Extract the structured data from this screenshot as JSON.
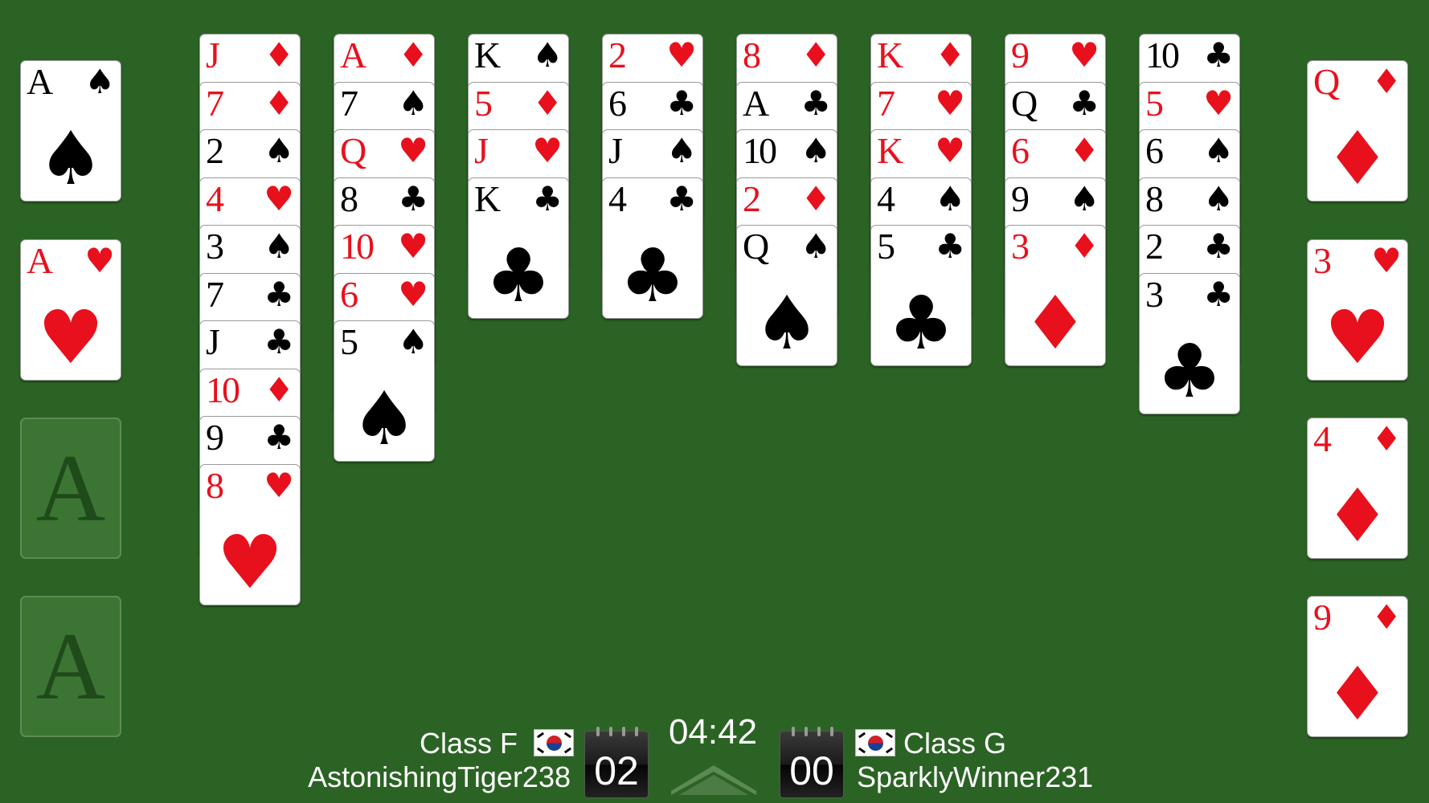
{
  "colors": {
    "felt": "#2b6324",
    "red_suit": "#e8101c",
    "black_suit": "#000000",
    "placeholder_fill": "#3c7533"
  },
  "left_foundations": [
    {
      "type": "card",
      "rank": "A",
      "suit": "♠",
      "color": "black"
    },
    {
      "type": "card",
      "rank": "A",
      "suit": "♥",
      "color": "red"
    },
    {
      "type": "empty",
      "label": "A"
    },
    {
      "type": "empty",
      "label": "A"
    }
  ],
  "right_cells": [
    {
      "rank": "Q",
      "suit": "♦",
      "color": "red"
    },
    {
      "rank": "3",
      "suit": "♥",
      "color": "red"
    },
    {
      "rank": "4",
      "suit": "♦",
      "color": "red"
    },
    {
      "rank": "9",
      "suit": "♦",
      "color": "red"
    }
  ],
  "tableau": [
    [
      {
        "rank": "J",
        "suit": "♦",
        "color": "red"
      },
      {
        "rank": "7",
        "suit": "♦",
        "color": "red"
      },
      {
        "rank": "2",
        "suit": "♠",
        "color": "black"
      },
      {
        "rank": "4",
        "suit": "♥",
        "color": "red"
      },
      {
        "rank": "3",
        "suit": "♠",
        "color": "black"
      },
      {
        "rank": "7",
        "suit": "♣",
        "color": "black"
      },
      {
        "rank": "J",
        "suit": "♣",
        "color": "black"
      },
      {
        "rank": "10",
        "suit": "♦",
        "color": "red"
      },
      {
        "rank": "9",
        "suit": "♣",
        "color": "black"
      },
      {
        "rank": "8",
        "suit": "♥",
        "color": "red"
      }
    ],
    [
      {
        "rank": "A",
        "suit": "♦",
        "color": "red"
      },
      {
        "rank": "7",
        "suit": "♠",
        "color": "black"
      },
      {
        "rank": "Q",
        "suit": "♥",
        "color": "red"
      },
      {
        "rank": "8",
        "suit": "♣",
        "color": "black"
      },
      {
        "rank": "10",
        "suit": "♥",
        "color": "red"
      },
      {
        "rank": "6",
        "suit": "♥",
        "color": "red"
      },
      {
        "rank": "5",
        "suit": "♠",
        "color": "black"
      }
    ],
    [
      {
        "rank": "K",
        "suit": "♠",
        "color": "black"
      },
      {
        "rank": "5",
        "suit": "♦",
        "color": "red"
      },
      {
        "rank": "J",
        "suit": "♥",
        "color": "red"
      },
      {
        "rank": "K",
        "suit": "♣",
        "color": "black"
      }
    ],
    [
      {
        "rank": "2",
        "suit": "♥",
        "color": "red"
      },
      {
        "rank": "6",
        "suit": "♣",
        "color": "black"
      },
      {
        "rank": "J",
        "suit": "♠",
        "color": "black"
      },
      {
        "rank": "4",
        "suit": "♣",
        "color": "black"
      }
    ],
    [
      {
        "rank": "8",
        "suit": "♦",
        "color": "red"
      },
      {
        "rank": "A",
        "suit": "♣",
        "color": "black"
      },
      {
        "rank": "10",
        "suit": "♠",
        "color": "black"
      },
      {
        "rank": "2",
        "suit": "♦",
        "color": "red"
      },
      {
        "rank": "Q",
        "suit": "♠",
        "color": "black"
      }
    ],
    [
      {
        "rank": "K",
        "suit": "♦",
        "color": "red"
      },
      {
        "rank": "7",
        "suit": "♥",
        "color": "red"
      },
      {
        "rank": "K",
        "suit": "♥",
        "color": "red"
      },
      {
        "rank": "4",
        "suit": "♠",
        "color": "black"
      },
      {
        "rank": "5",
        "suit": "♣",
        "color": "black"
      }
    ],
    [
      {
        "rank": "9",
        "suit": "♥",
        "color": "red"
      },
      {
        "rank": "Q",
        "suit": "♣",
        "color": "black"
      },
      {
        "rank": "6",
        "suit": "♦",
        "color": "red"
      },
      {
        "rank": "9",
        "suit": "♠",
        "color": "black"
      },
      {
        "rank": "3",
        "suit": "♦",
        "color": "red"
      }
    ],
    [
      {
        "rank": "10",
        "suit": "♣",
        "color": "black"
      },
      {
        "rank": "5",
        "suit": "♥",
        "color": "red"
      },
      {
        "rank": "6",
        "suit": "♠",
        "color": "black"
      },
      {
        "rank": "8",
        "suit": "♠",
        "color": "black"
      },
      {
        "rank": "2",
        "suit": "♣",
        "color": "black"
      },
      {
        "rank": "3",
        "suit": "♣",
        "color": "black"
      }
    ]
  ],
  "bottom_bar": {
    "player_left": {
      "class": "Class F",
      "name": "AstonishingTiger238",
      "flag": "korea-flag-icon",
      "score": "02"
    },
    "player_right": {
      "class": "Class G",
      "name": "SparklyWinner231",
      "flag": "korea-flag-icon",
      "score": "00"
    },
    "timer": "04:42",
    "expand_icon": "chevron-up-icon"
  }
}
